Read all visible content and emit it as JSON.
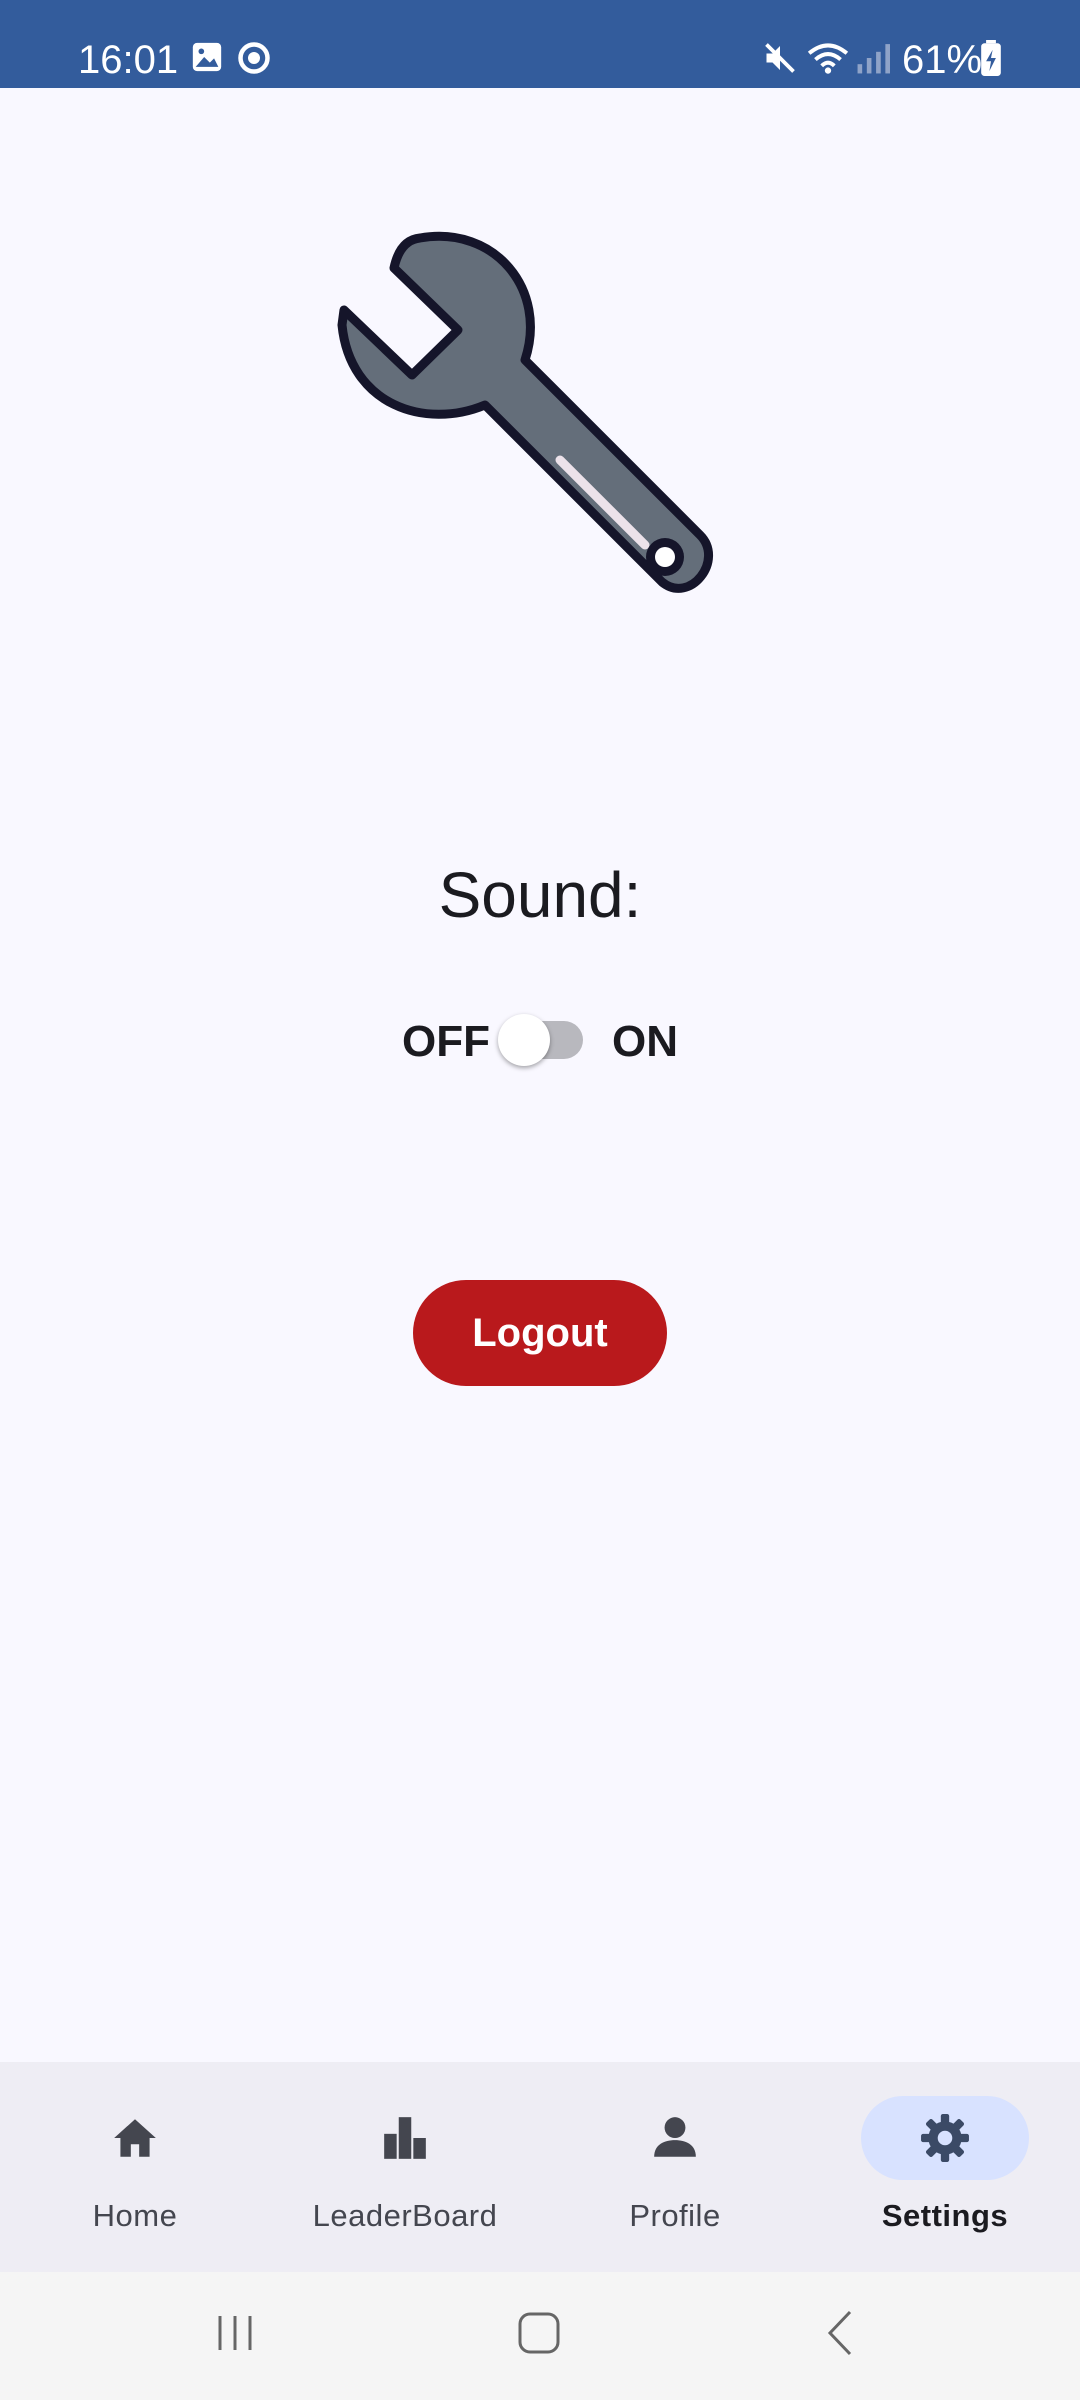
{
  "status_bar": {
    "time": "16:01",
    "battery": "61%",
    "background": "#335c9c"
  },
  "illustration": {
    "icon": "wrench-icon"
  },
  "sound": {
    "label": "Sound:",
    "off_label": "OFF",
    "on_label": "ON",
    "enabled": false
  },
  "logout": {
    "label": "Logout",
    "color": "#b9191c"
  },
  "bottom_nav": {
    "items": [
      {
        "label": "Home",
        "icon": "home-icon",
        "active": false
      },
      {
        "label": "LeaderBoard",
        "icon": "leaderboard-icon",
        "active": false
      },
      {
        "label": "Profile",
        "icon": "profile-icon",
        "active": false
      },
      {
        "label": "Settings",
        "icon": "settings-icon",
        "active": true
      }
    ],
    "active_pill_color": "#d8e2ff"
  },
  "system_nav": {
    "buttons": [
      "recent-apps-icon",
      "home-button-icon",
      "back-icon"
    ]
  }
}
